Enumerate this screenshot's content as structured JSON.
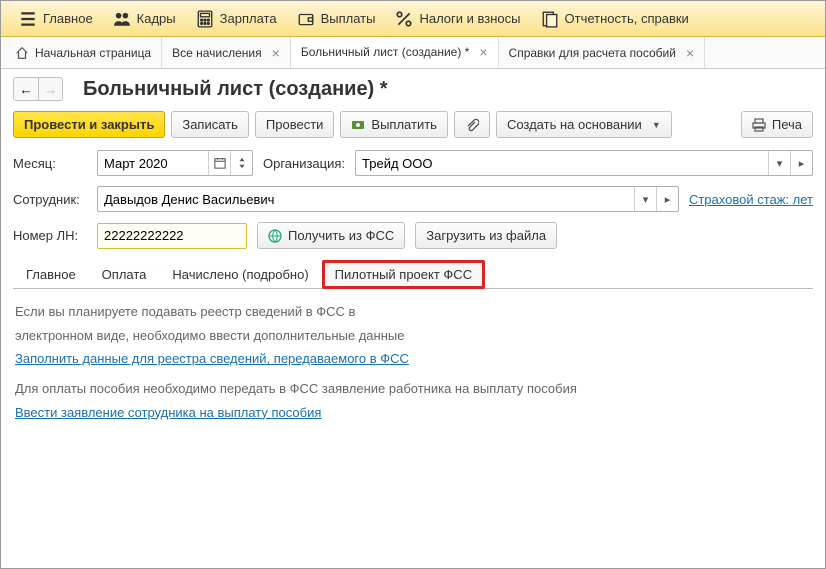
{
  "topmenu": [
    {
      "icon": "hamburger",
      "label": "Главное"
    },
    {
      "icon": "people",
      "label": "Кадры"
    },
    {
      "icon": "calc",
      "label": "Зарплата"
    },
    {
      "icon": "wallet",
      "label": "Выплаты"
    },
    {
      "icon": "percent",
      "label": "Налоги и взносы"
    },
    {
      "icon": "report",
      "label": "Отчетность, справки"
    }
  ],
  "navtabs": {
    "home": "Начальная страница",
    "t1": "Все начисления",
    "t2": "Больничный лист (создание) *",
    "t3": "Справки для расчета пособий"
  },
  "page_title": "Больничный лист (создание) *",
  "toolbar": {
    "post_close": "Провести и закрыть",
    "save": "Записать",
    "post": "Провести",
    "pay": "Выплатить",
    "create_based": "Создать на основании",
    "print": "Печа"
  },
  "fields": {
    "month_label": "Месяц:",
    "month_value": "Март 2020",
    "org_label": "Организация:",
    "org_value": "Трейд ООО",
    "employee_label": "Сотрудник:",
    "employee_value": "Давыдов Денис Васильевич",
    "stazh_link": "Страховой стаж: лет",
    "nomer_label": "Номер ЛН:",
    "nomer_value": "22222222222",
    "get_fss": "Получить из ФСС",
    "load_file": "Загрузить из файла"
  },
  "doc_tabs": {
    "main": "Главное",
    "pay": "Оплата",
    "calc": "Начислено (подробно)",
    "pilot": "Пилотный проект ФСС"
  },
  "content": {
    "p1a": "Если вы планируете подавать реестр сведений в ФСС в",
    "p1b": "электронном виде, необходимо ввести дополнительные данные",
    "link1": "Заполнить данные для реестра сведений, передаваемого в ФСС",
    "p2": "Для оплаты пособия необходимо передать в ФСС заявление работника на выплату пособия",
    "link2": "Ввести заявление сотрудника на выплату пособия"
  }
}
